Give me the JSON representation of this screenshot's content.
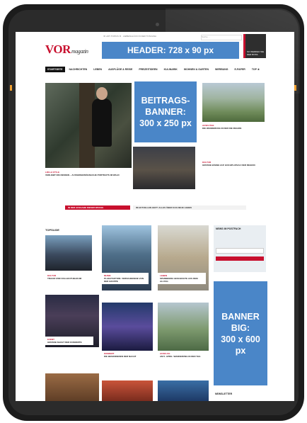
{
  "ads": {
    "header": "HEADER: 728 x 90 px",
    "beitrags_line1": "BEITRAGS-",
    "beitrags_line2": "BANNER:",
    "beitrags_line3": "300 x 250 px",
    "big_line1": "BANNER",
    "big_line2": "BIG:",
    "big_line3": "300 x 600",
    "big_line4": "px"
  },
  "logo": {
    "main": "VOR",
    "sub": "magazin"
  },
  "topbar": {
    "links": "★ HOT-TOPICS ★ · LIEBESGLÜCK IN DER TOSCANA",
    "search": "Suche ..."
  },
  "user_card": {
    "text": "SO WERDEN SIE DER BOSS"
  },
  "nav": [
    "STARTSEITE",
    "NACHRICHTEN",
    "LEBEN",
    "AUSFLÜGE & REISE",
    "FREIZEITIDEEN",
    "KULINARIK",
    "WOHNEN & GARTEN",
    "WERBUNG",
    "E-PAPER",
    "TOP ★"
  ],
  "articles": {
    "a1_tag": "LIFE & STYLE",
    "a1_title": "VERLIEBT INS DENKEN – AUSSERGEWÖHNLICHE PORTRAITS IM WALD",
    "a2_tag": "AUSFLÜGE",
    "a2_title": "DIE WANDERUNG IN DER DIE REGION",
    "a3_tag": "KULTUR",
    "a3_title": "GROSSE BÜHNE AUF HOCHPLATEAU DER REGION"
  },
  "promo": {
    "text": "IN DER AUSGABE DIESER WOCHE",
    "link": "IM AKTUELLEN HEFT: ALLES ÜBER DAS NEUE LEBEN"
  },
  "section": {
    "title": "TOPSLIDE"
  },
  "grid": {
    "c1_tag": "KULTUR",
    "c1_title": "TRAUM VOM VOLLEN PUBLIKUM",
    "c2_tag": "MUSIK",
    "c2_title": "PLAKATAKTION: VERSCHIEDENE VON DER GRUPPE",
    "c3_tag": "LEBEN",
    "c3_title": "SPANNENDE GESCHICHTE AUS DEM ALLTAG",
    "c4_tag": "EVENT",
    "c4_title": "GROSSE NACHT DER KONZERTE",
    "c5_tag": "KONZERT",
    "c5_title": "DIE BESONDEREN DER NACHT",
    "c6_tag": "AUSFLUG",
    "c6_title": "AM 5. APRIL: WANDERUNG IN DEN TAG"
  },
  "newsletter": {
    "title": "NEWS IM POSTFACH"
  },
  "bottom": {
    "label": "NEWSLETTER"
  },
  "colors": {
    "accent": "#c8102e",
    "ad_blue": "#4a86c8"
  }
}
